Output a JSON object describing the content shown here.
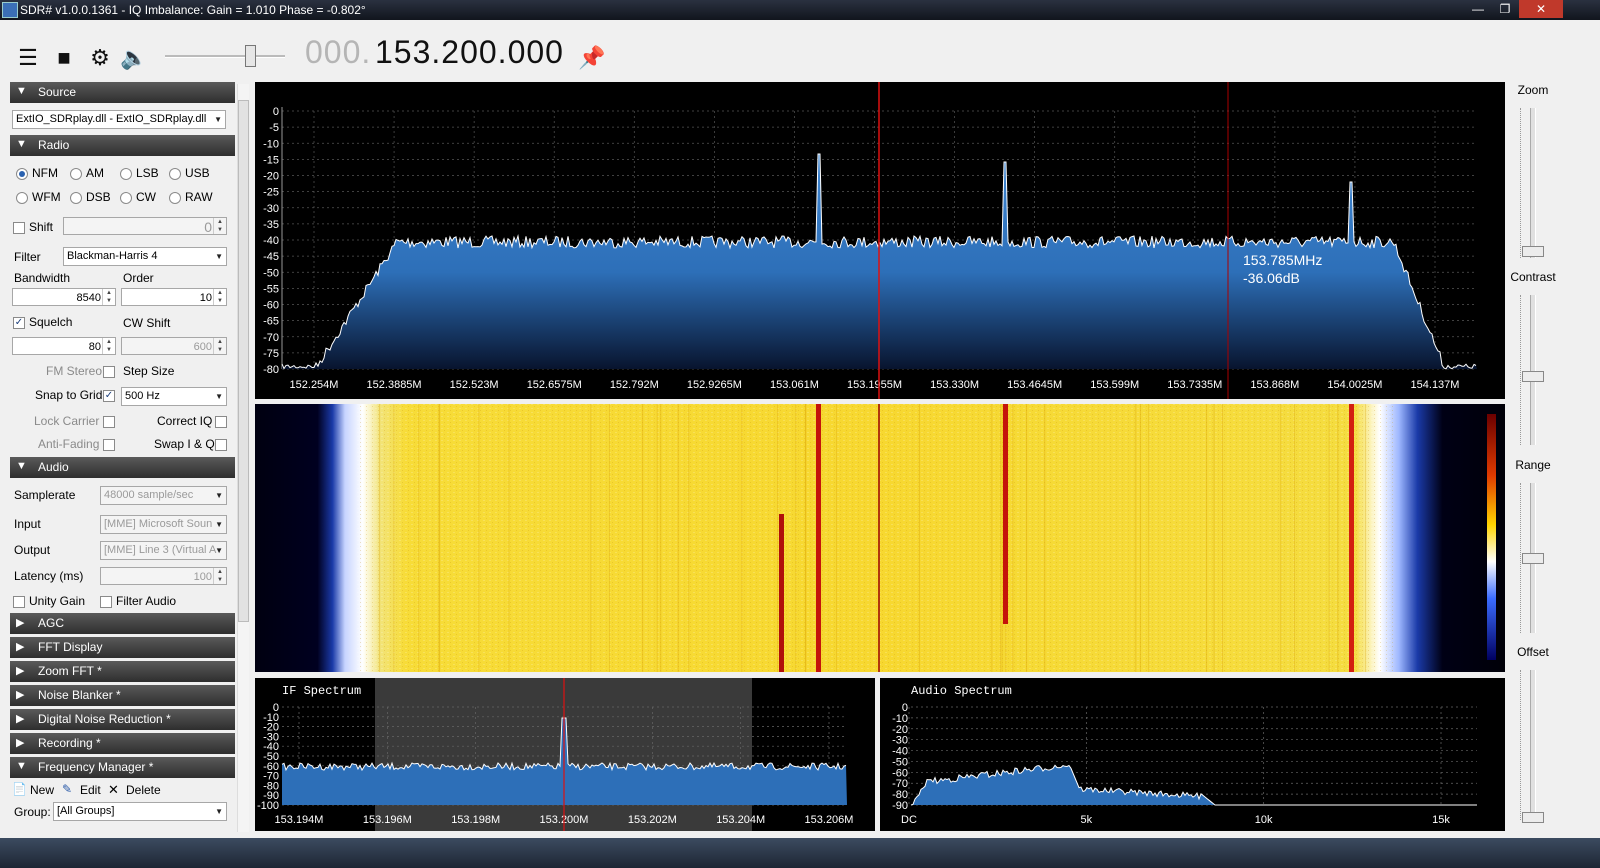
{
  "window": {
    "title": "SDR# v1.0.0.1361 - IQ Imbalance: Gain = 1.010 Phase = -0.802°"
  },
  "toolbar": {
    "freq_dim": "000.",
    "freq_main": "153.200.000"
  },
  "sections": {
    "source": "Source",
    "radio": "Radio",
    "audio": "Audio",
    "agc": "AGC",
    "fft_display": "FFT Display",
    "zoom_fft": "Zoom FFT *",
    "noise_blanker": "Noise Blanker *",
    "dnr": "Digital Noise Reduction *",
    "recording": "Recording *",
    "freq_manager": "Frequency Manager *"
  },
  "source": {
    "device": "ExtIO_SDRplay.dll - ExtIO_SDRplay.dll"
  },
  "radio": {
    "modes": [
      "NFM",
      "AM",
      "LSB",
      "USB",
      "WFM",
      "DSB",
      "CW",
      "RAW"
    ],
    "selected_mode": "NFM",
    "shift_label": "Shift",
    "shift_value": "0",
    "filter_label": "Filter",
    "filter_value": "Blackman-Harris 4",
    "bandwidth_label": "Bandwidth",
    "bandwidth_value": "8540",
    "order_label": "Order",
    "order_value": "10",
    "squelch_label": "Squelch",
    "squelch_value": "80",
    "cwshift_label": "CW Shift",
    "cwshift_value": "600",
    "fmstereo_label": "FM Stereo",
    "stepsize_label": "Step Size",
    "snap_label": "Snap to Grid",
    "snap_value": "500 Hz",
    "lock_label": "Lock Carrier",
    "correctiq_label": "Correct IQ",
    "antifading_label": "Anti-Fading",
    "swapiq_label": "Swap I & Q"
  },
  "audio": {
    "samplerate_label": "Samplerate",
    "samplerate_value": "48000 sample/sec",
    "input_label": "Input",
    "input_value": "[MME] Microsoft Soun",
    "output_label": "Output",
    "output_value": "[MME] Line 3 (Virtual A",
    "latency_label": "Latency (ms)",
    "latency_value": "100",
    "unity_label": "Unity Gain",
    "filter_audio_label": "Filter Audio"
  },
  "freq_manager": {
    "new_label": "New",
    "edit_label": "Edit",
    "delete_label": "Delete",
    "group_label": "Group:",
    "group_value": "[All Groups]"
  },
  "spectrum": {
    "db_ticks": [
      "0",
      "-5",
      "-10",
      "-15",
      "-20",
      "-25",
      "-30",
      "-35",
      "-40",
      "-45",
      "-50",
      "-55",
      "-60",
      "-65",
      "-70",
      "-75",
      "-80"
    ],
    "freq_ticks": [
      "152.254M",
      "152.3885M",
      "152.523M",
      "152.6575M",
      "152.792M",
      "152.9265M",
      "153.061M",
      "153.1955M",
      "153.330M",
      "153.4645M",
      "153.599M",
      "153.7335M",
      "153.868M",
      "154.0025M",
      "154.137M"
    ],
    "cursor_freq": "153.785MHz",
    "cursor_db": "-36.06dB",
    "fill_color": "#2d6fb8",
    "line_color": "#ffffff"
  },
  "if_spectrum": {
    "title": "IF Spectrum",
    "db_ticks": [
      "0",
      "-10",
      "-20",
      "-30",
      "-40",
      "-50",
      "-60",
      "-70",
      "-80",
      "-90",
      "-100"
    ],
    "freq_ticks": [
      "153.194M",
      "153.196M",
      "153.198M",
      "153.200M",
      "153.202M",
      "153.204M",
      "153.206M"
    ]
  },
  "audio_spectrum": {
    "title": "Audio Spectrum",
    "db_ticks": [
      "0",
      "-10",
      "-20",
      "-30",
      "-40",
      "-50",
      "-60",
      "-70",
      "-80",
      "-90"
    ],
    "freq_ticks": [
      "DC",
      "5k",
      "10k",
      "15k"
    ]
  },
  "right_panel": {
    "zoom": "Zoom",
    "contrast": "Contrast",
    "range": "Range",
    "offset": "Offset"
  },
  "icons": {
    "menu": "menu-icon",
    "stop": "stop-icon",
    "settings": "gear-icon",
    "volume": "speaker-icon",
    "pin": "pin-icon"
  }
}
